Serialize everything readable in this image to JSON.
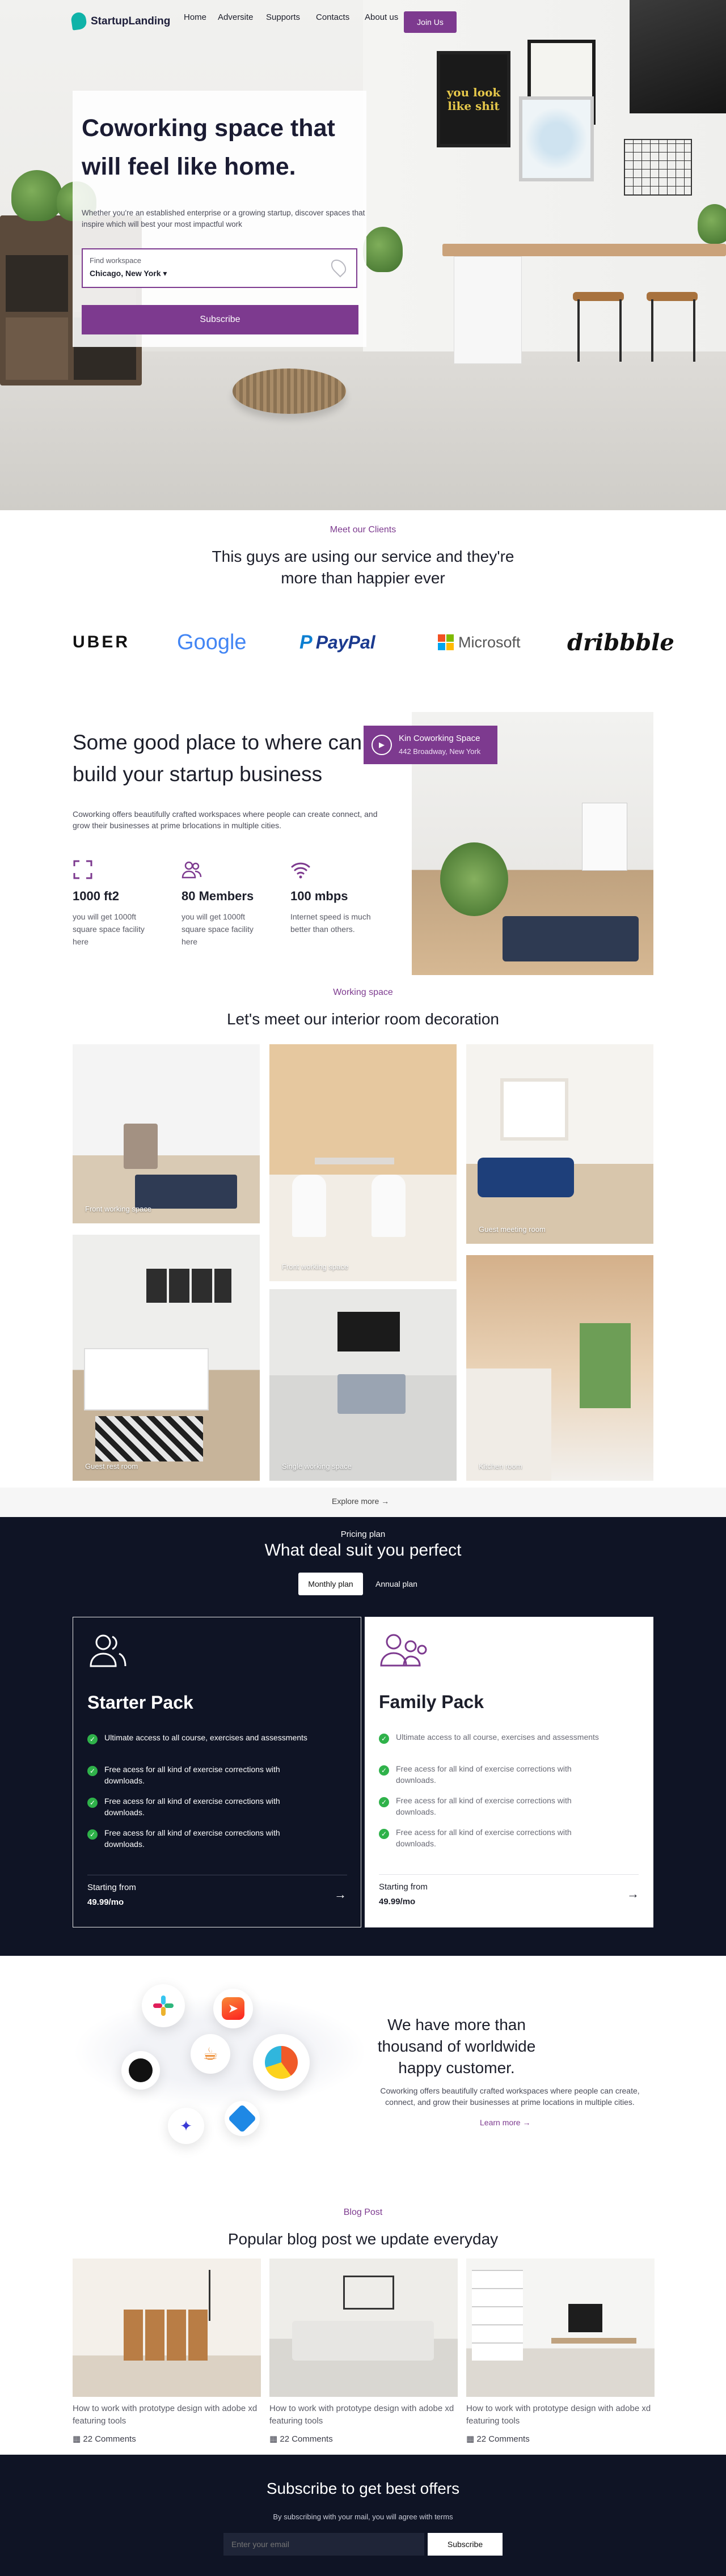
{
  "brand": {
    "name": "StartupLanding",
    "accent": "#7d3a8f",
    "logo_color": "#0fb3a8",
    "dark": "#0f1425"
  },
  "nav": {
    "links": [
      "Home",
      "Adversite",
      "Supports",
      "Contacts",
      "About us"
    ],
    "join_label": "Join Us"
  },
  "hero": {
    "title": "Coworking space that will feel like home.",
    "subtitle": "Whether you're an established enterprise or a growing startup, discover spaces that inspire which will best your most impactful work",
    "search_label": "Find workspace",
    "search_value": "Chicago, New York",
    "subscribe_label": "Subscribe",
    "poster_text": "you look like shit"
  },
  "clients": {
    "eyebrow": "Meet our Clients",
    "title": "This guys are using our service and they're more than happier ever",
    "logos": [
      "UBER",
      "Google",
      "PayPal",
      "Microsoft",
      "dribbble"
    ]
  },
  "startup": {
    "title": "Some good place to where can build your startup business",
    "description": "Coworking offers beautifully crafted workspaces where people can create connect, and grow their businesses at prime brlocations in multiple cities.",
    "location_name": "Kin Coworking Space",
    "location_address": "442 Broadway, New York",
    "stats": [
      {
        "icon": "expand-icon",
        "value": "1000 ft2",
        "desc": "you will get 1000ft square space facility here"
      },
      {
        "icon": "members-icon",
        "value": "80 Members",
        "desc": "you will get 1000ft square space facility here"
      },
      {
        "icon": "wifi-icon",
        "value": "100 mbps",
        "desc": "Internet speed is much better than others."
      }
    ]
  },
  "gallery": {
    "eyebrow": "Working space",
    "title": "Let's meet our interior room decoration",
    "rooms": [
      "Front working space",
      "Front working space",
      "Guest meeting room",
      "Guest rest room",
      "Single working space",
      "Kitchen room"
    ],
    "explore_label": "Explore more"
  },
  "pricing": {
    "eyebrow": "Pricing plan",
    "title": "What deal suit you perfect",
    "toggle": [
      "Monthly plan",
      "Annual plan"
    ],
    "plans": [
      {
        "name": "Starter Pack",
        "features": [
          "Ultimate access to all course, exercises and assessments",
          "Free acess for all kind of exercise corrections with downloads.",
          "Free acess for all kind of exercise corrections with downloads.",
          "Free acess for all kind of exercise corrections with downloads."
        ],
        "start_label": "Starting from",
        "price": "49.99/mo"
      },
      {
        "name": "Family Pack",
        "features": [
          "Ultimate access to all course, exercises and assessments",
          "Free acess for all kind of exercise corrections with downloads.",
          "Free acess for all kind of exercise corrections with downloads.",
          "Free acess for all kind of exercise corrections with downloads."
        ],
        "start_label": "Starting from",
        "price": "49.99/mo"
      }
    ]
  },
  "customers": {
    "title": "We have more than thousand of worldwide happy customer.",
    "description": "Coworking offers beautifully crafted workspaces where people can create, connect, and grow their businesses at prime locations in multiple cities.",
    "learn_label": "Learn more",
    "apps": [
      "slack-icon",
      "swift-icon",
      "github-icon",
      "java-icon",
      "pie-app-icon",
      "bird-icon",
      "chevron-app-icon"
    ]
  },
  "blog": {
    "eyebrow": "Blog Post",
    "title": "Popular blog post we update everyday",
    "posts": [
      {
        "title": "How to work with prototype design with adobe xd featuring tools",
        "comments": "22 Comments"
      },
      {
        "title": "How to work with prototype design with adobe xd featuring tools",
        "comments": "22 Comments"
      },
      {
        "title": "How to work with prototype design with adobe xd featuring tools",
        "comments": "22 Comments"
      }
    ]
  },
  "subscribe": {
    "title": "Subscribe to get best offers",
    "subtitle": "By subscribing with your mail, you will agree with terms",
    "placeholder": "Enter your email",
    "button": "Subscribe"
  }
}
